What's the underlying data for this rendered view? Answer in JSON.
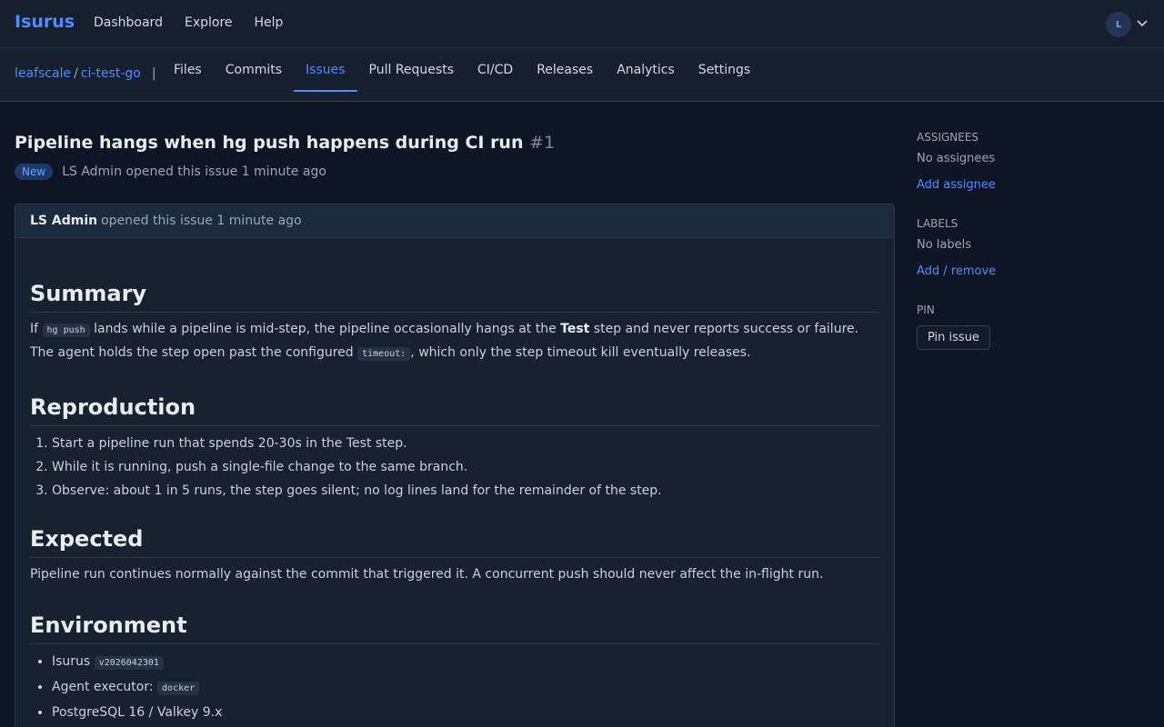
{
  "header": {
    "brand": "Isurus",
    "nav": [
      "Dashboard",
      "Explore",
      "Help"
    ],
    "avatar_initial": "L"
  },
  "repo": {
    "owner": "leafscale",
    "name": "ci-test-go",
    "tabs": [
      {
        "label": "Files",
        "active": false
      },
      {
        "label": "Commits",
        "active": false
      },
      {
        "label": "Issues",
        "active": true
      },
      {
        "label": "Pull Requests",
        "active": false
      },
      {
        "label": "CI/CD",
        "active": false
      },
      {
        "label": "Releases",
        "active": false
      },
      {
        "label": "Analytics",
        "active": false
      },
      {
        "label": "Settings",
        "active": false
      }
    ]
  },
  "issue": {
    "title": "Pipeline hangs when hg push happens during CI run",
    "number": "#1",
    "status": "New",
    "opened_line": "LS Admin opened this issue 1 minute ago",
    "comment": {
      "author": "LS Admin",
      "ago": "opened this issue 1 minute ago",
      "summary_heading": "Summary",
      "summary_p1_a": "If ",
      "summary_code1": "hg push",
      "summary_p1_b": " lands while a pipeline is mid-step, the pipeline occasionally hangs at the ",
      "summary_bold": "Test",
      "summary_p1_c": " step and never reports success or failure. The agent holds the step open past the configured ",
      "summary_code2": "timeout:",
      "summary_p1_d": ", which only the step timeout kill eventually releases.",
      "repro_heading": "Reproduction",
      "repro_steps": [
        "Start a pipeline run that spends 20-30s in the Test step.",
        "While it is running, push a single-file change to the same branch.",
        "Observe: about 1 in 5 runs, the step goes silent; no log lines land for the remainder of the step."
      ],
      "expected_heading": "Expected",
      "expected_text": "Pipeline run continues normally against the commit that triggered it. A concurrent push should never affect the in-flight run.",
      "env_heading": "Environment",
      "env_isurus_label": "Isurus ",
      "env_isurus_code": "v2026042301",
      "env_agent_label": "Agent executor: ",
      "env_agent_code": "docker",
      "env_db": "PostgreSQL 16 / Valkey 9.x"
    }
  },
  "sidebar": {
    "assignees_label": "ASSIGNEES",
    "assignees_value": "No assignees",
    "assignees_link": "Add assignee",
    "labels_label": "LABELS",
    "labels_value": "No labels",
    "labels_link": "Add / remove",
    "pin_label": "PIN",
    "pin_button": "Pin issue"
  }
}
